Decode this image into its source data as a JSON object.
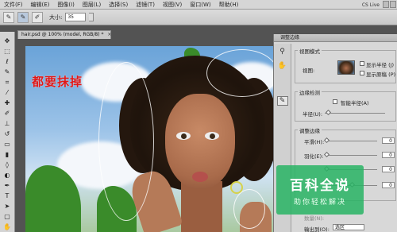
{
  "menu": {
    "items": [
      "文件(F)",
      "编辑(E)",
      "图像(I)",
      "图层(L)",
      "选择(S)",
      "滤镜(T)",
      "视图(V)",
      "窗口(W)",
      "帮助(H)"
    ],
    "cs_live": "CS Live"
  },
  "options": {
    "size_label": "大小:",
    "size_value": "35"
  },
  "document": {
    "tab_label": "hair.psd @ 100% (model, RGB/8) *",
    "close_glyph": "×"
  },
  "canvas": {
    "annotation": "都要抹掉"
  },
  "dialog": {
    "title": "调整边缘",
    "view_mode": {
      "title": "视图模式",
      "view_label": "视图:",
      "show_radius": "显示半径 (J)",
      "show_original": "显示原稿 (P)"
    },
    "edge_detection": {
      "title": "边缘检测",
      "smart_radius": "智能半径(A)",
      "radius_label": "半径(U):"
    },
    "adjust_edge": {
      "title": "调整边缘",
      "smooth_label": "平滑(H):",
      "smooth_value": "0",
      "feather_label": "羽化(E):",
      "feather_value": "0",
      "contrast_value": "0",
      "shift_value": "0"
    },
    "output": {
      "amount_label": "数量(N):",
      "output_to_label": "输出到(O):",
      "output_to_value": "选区"
    }
  },
  "watermark": {
    "line1": "百科全说",
    "line2": "助你轻松解决"
  },
  "icons": {
    "zoom": "zoom-icon",
    "hand": "hand-icon",
    "refine_radius_brush": "refine-radius-brush-icon"
  }
}
